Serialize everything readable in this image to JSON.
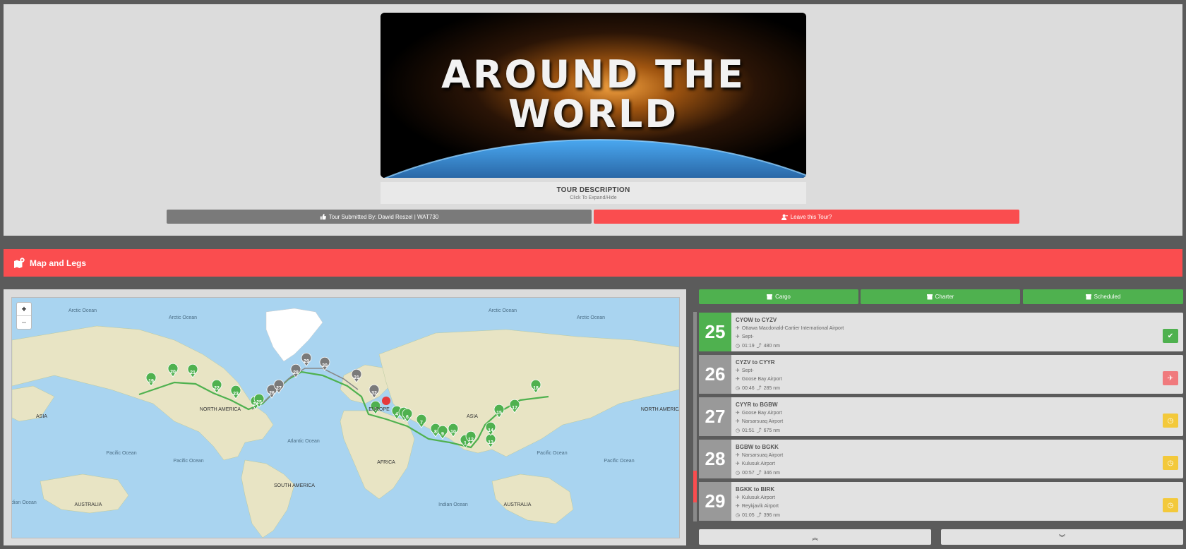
{
  "banner": {
    "title": "AROUND THE\nWORLD"
  },
  "tour_description": {
    "title": "TOUR DESCRIPTION",
    "hint": "Click To Expand/Hide"
  },
  "submitted": {
    "label": "Tour Submitted By: Dawid Reszel | WAT730",
    "icon": "thumbs-up-icon"
  },
  "leave": {
    "label": "Leave this Tour?",
    "icon": "user-minus-icon"
  },
  "map_section": {
    "title": "Map and Legs",
    "icon": "map-pin-icon"
  },
  "map": {
    "zoom_in": "+",
    "zoom_out": "−",
    "labels": [
      "Arctic Ocean",
      "Arctic Ocean",
      "Arctic Ocean",
      "Arctic Ocean",
      "ASIA",
      "NORTH AMERICA",
      "Atlantic Ocean",
      "EUROPE",
      "ASIA",
      "NORTH AMERICA",
      "AFRICA",
      "Pacific Ocean",
      "Pacific Ocean",
      "Pacific Ocean",
      "Pacific Ocean",
      "SOUTH AMERICA",
      "Indian Ocean",
      "AUSTRALIA",
      "AUSTRALIA",
      "Indian Ocean"
    ],
    "markers": [
      "1",
      "3",
      "4",
      "5",
      "6",
      "7",
      "8",
      "9",
      "10",
      "12",
      "13",
      "14",
      "15",
      "17",
      "18",
      "19",
      "20",
      "21",
      "22",
      "23",
      "24",
      "25",
      "26",
      "27",
      "28",
      "29",
      "30",
      "31",
      "32"
    ]
  },
  "categories": [
    {
      "label": "Cargo",
      "icon": "box-icon"
    },
    {
      "label": "Charter",
      "icon": "box-icon"
    },
    {
      "label": "Scheduled",
      "icon": "box-icon"
    }
  ],
  "legs": [
    {
      "num": "25",
      "title": "CYOW to CYZV",
      "dep": "Ottawa Macdonald-Cartier International Airport",
      "arr": "Sept-",
      "time": "01:19",
      "dist": "480 nm",
      "status_icon": "check-icon",
      "status": "completed"
    },
    {
      "num": "26",
      "title": "CYZV to CYYR",
      "dep": "Sept-",
      "arr": "Goose Bay Airport",
      "time": "00:46",
      "dist": "285 nm",
      "status_icon": "plane-icon",
      "status": "current"
    },
    {
      "num": "27",
      "title": "CYYR to BGBW",
      "dep": "Goose Bay Airport",
      "arr": "Narsarsuaq Airport",
      "time": "01:51",
      "dist": "675 nm",
      "status_icon": "clock-icon",
      "status": "pending"
    },
    {
      "num": "28",
      "title": "BGBW to BGKK",
      "dep": "Narsarsuaq Airport",
      "arr": "Kulusuk Airport",
      "time": "00:57",
      "dist": "346 nm",
      "status_icon": "clock-icon",
      "status": "pending"
    },
    {
      "num": "29",
      "title": "BGKK to BIRK",
      "dep": "Kulusuk Airport",
      "arr": "Reykjavik Airport",
      "time": "01:05",
      "dist": "396 nm",
      "status_icon": "clock-icon",
      "status": "pending"
    }
  ],
  "pager": {
    "up": "︽",
    "down": "︾"
  }
}
